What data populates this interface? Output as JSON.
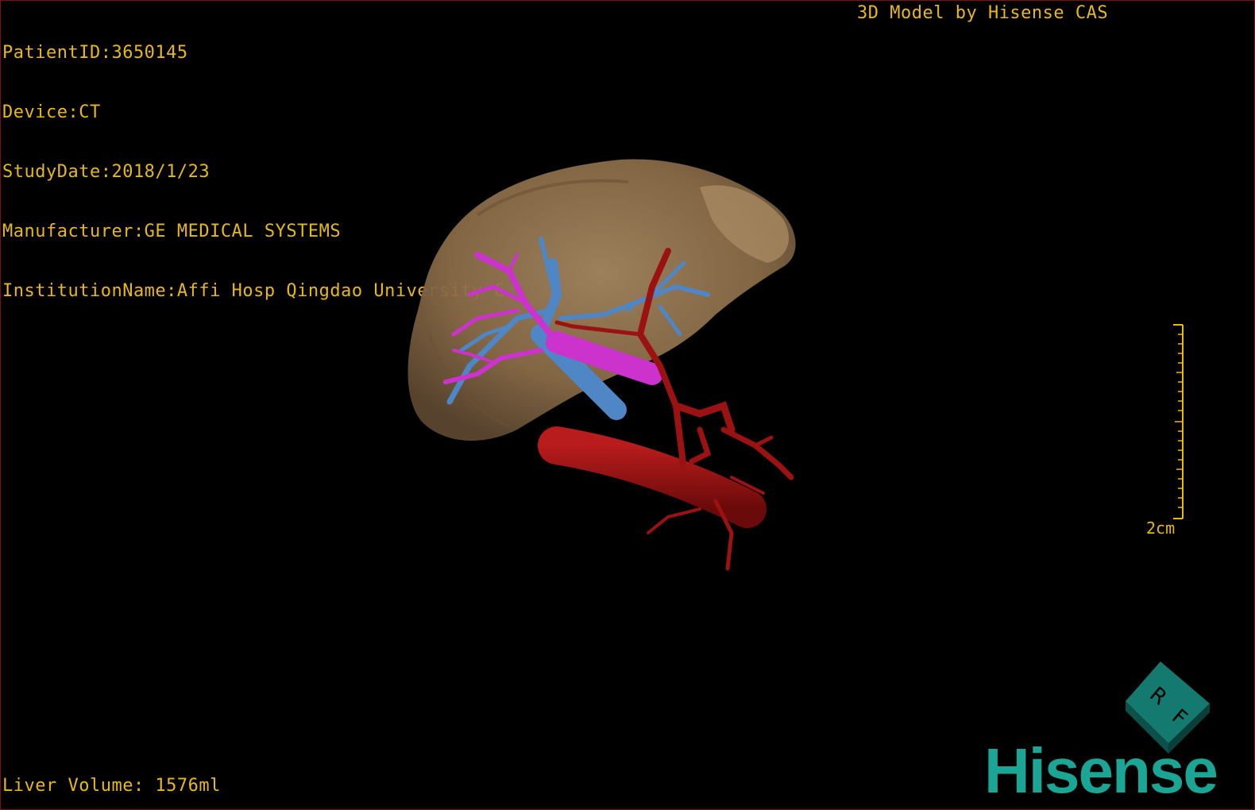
{
  "patient_info": {
    "patient_id": "PatientID:3650145",
    "device": "Device:CT",
    "study_date": "StudyDate:2018/1/23",
    "manufacturer": "Manufacturer:GE MEDICAL SYSTEMS",
    "institution": "InstitutionName:Affi Hosp Qingdao University C"
  },
  "header": {
    "title": "3D Model by Hisense CAS"
  },
  "footer": {
    "liver_volume": "Liver Volume: 1576ml"
  },
  "scale": {
    "label": "2cm"
  },
  "orientation_cube": {
    "label_right": "R",
    "label_front": "F",
    "icon": "orientation-cube-icon"
  },
  "brand": {
    "logo_text": "Hisense"
  },
  "colors": {
    "overlay_text": "#e8b818",
    "liver": "#8a6c48",
    "portal_vein": "#4f86c6",
    "hepatic_vein": "#cc33cc",
    "artery": "#9a1212",
    "brand": "#1aa594"
  }
}
